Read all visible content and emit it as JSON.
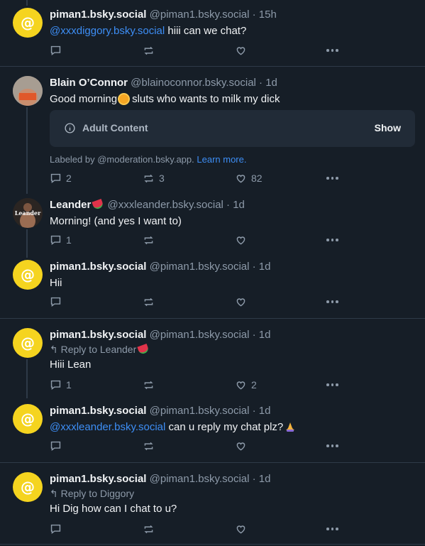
{
  "posts": [
    {
      "name": "piman1.bsky.social",
      "handle": "@piman1.bsky.social · 15h",
      "mention": "@xxxdiggory.bsky.social",
      "text": " hiii can we chat?",
      "replies": "",
      "reposts": "",
      "likes": ""
    },
    {
      "name": "Blain O’Connor",
      "handle": "@blainoconnor.bsky.social · 1d",
      "text_before": "Good morning",
      "text_after": "sluts who wants to milk my dick",
      "adult_label": "Adult Content",
      "adult_show": "Show",
      "labeled_by": "Labeled by @moderation.bsky.app.",
      "learn_more": "Learn more.",
      "replies": "2",
      "reposts": "3",
      "likes": "82"
    },
    {
      "name": "Leander",
      "handle": "@xxxleander.bsky.social · 1d",
      "text": "Morning! (and yes I want to)",
      "replies": "1",
      "reposts": "",
      "likes": ""
    },
    {
      "name": "piman1.bsky.social",
      "handle": "@piman1.bsky.social · 1d",
      "text": "Hii",
      "replies": "",
      "reposts": "",
      "likes": ""
    },
    {
      "name": "piman1.bsky.social",
      "handle": "@piman1.bsky.social · 1d",
      "reply_to": "Reply to Leander",
      "text": "Hiii Lean",
      "replies": "1",
      "reposts": "",
      "likes": "2"
    },
    {
      "name": "piman1.bsky.social",
      "handle": "@piman1.bsky.social · 1d",
      "mention": "@xxxleander.bsky.social",
      "text": " can u reply my chat plz?",
      "replies": "",
      "reposts": "",
      "likes": ""
    },
    {
      "name": "piman1.bsky.social",
      "handle": "@piman1.bsky.social · 1d",
      "reply_to": "Reply to Diggory",
      "text": "Hi Dig how can I chat to u?",
      "replies": "",
      "reposts": "",
      "likes": ""
    }
  ],
  "avatar_text": "@",
  "avatar_photo_text": "Leander",
  "icons": {
    "reply": "reply-icon",
    "repost": "repost-icon",
    "like": "heart-icon",
    "more": "more-icon",
    "info": "info-icon"
  },
  "colors": {
    "background": "#161e27",
    "accent": "#3d8ef5",
    "avatar": "#f5d41f"
  }
}
